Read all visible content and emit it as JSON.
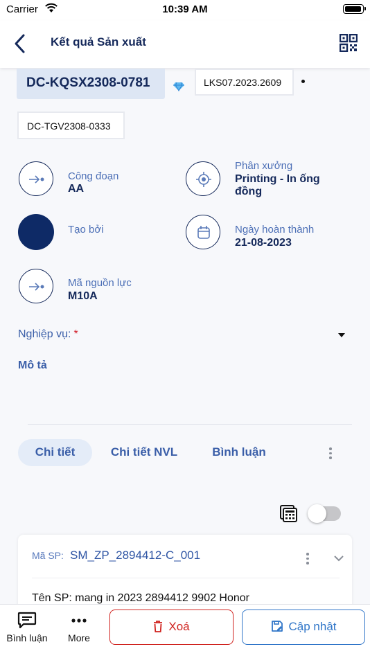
{
  "status_bar": {
    "carrier": "Carrier",
    "time": "10:39 AM"
  },
  "nav": {
    "title": "Kết quả Sản xuất"
  },
  "header": {
    "code": "DC-KQSX2308-0781",
    "ref1": "LKS07.2023.2609",
    "ref2": "DC-TGV2308-0333"
  },
  "fields": {
    "cong_doan_label": "Công đoạn",
    "cong_doan_value": "AA",
    "phan_xuong_label": "Phân xưởng",
    "phan_xuong_value_line1": "Printing - In ống",
    "phan_xuong_value_line2": "đồng",
    "tao_boi_label": "Tạo bởi",
    "ngay_label": "Ngày hoàn thành",
    "ngay_value": "21-08-2023",
    "ma_nguon_luc_label": "Mã nguồn lực",
    "ma_nguon_luc_value": "M10A"
  },
  "form": {
    "nghiep_vu_label": "Nghiệp vụ:",
    "required_mark": "*",
    "mo_ta_label": "Mô tả"
  },
  "tabs": [
    {
      "label": "Chi tiết",
      "active": true
    },
    {
      "label": "Chi tiết NVL",
      "active": false
    },
    {
      "label": "Bình luận",
      "active": false
    }
  ],
  "card": {
    "sp_label": "Mã SP:",
    "sp_code": "SM_ZP_2894412-C_001",
    "ten_sp": "Tên SP: mang in  2023  2894412  9902  Honor"
  },
  "bottom_bar": {
    "comment_label": "Bình luận",
    "more_label": "More",
    "delete_label": "Xoá",
    "update_label": "Cập nhật"
  },
  "colors": {
    "primary": "#14285a",
    "label": "#4c6fb6",
    "danger": "#d0231f",
    "accent": "#2f75c8"
  },
  "icons": [
    "wifi-icon",
    "battery-icon",
    "back-chevron-icon",
    "qr-code-icon",
    "diamond-icon",
    "arrow-right-icon",
    "target-icon",
    "calendar-icon",
    "calculator-icon",
    "chevron-down-icon",
    "chat-icon",
    "ellipsis-icon",
    "trash-icon",
    "save-icon"
  ]
}
